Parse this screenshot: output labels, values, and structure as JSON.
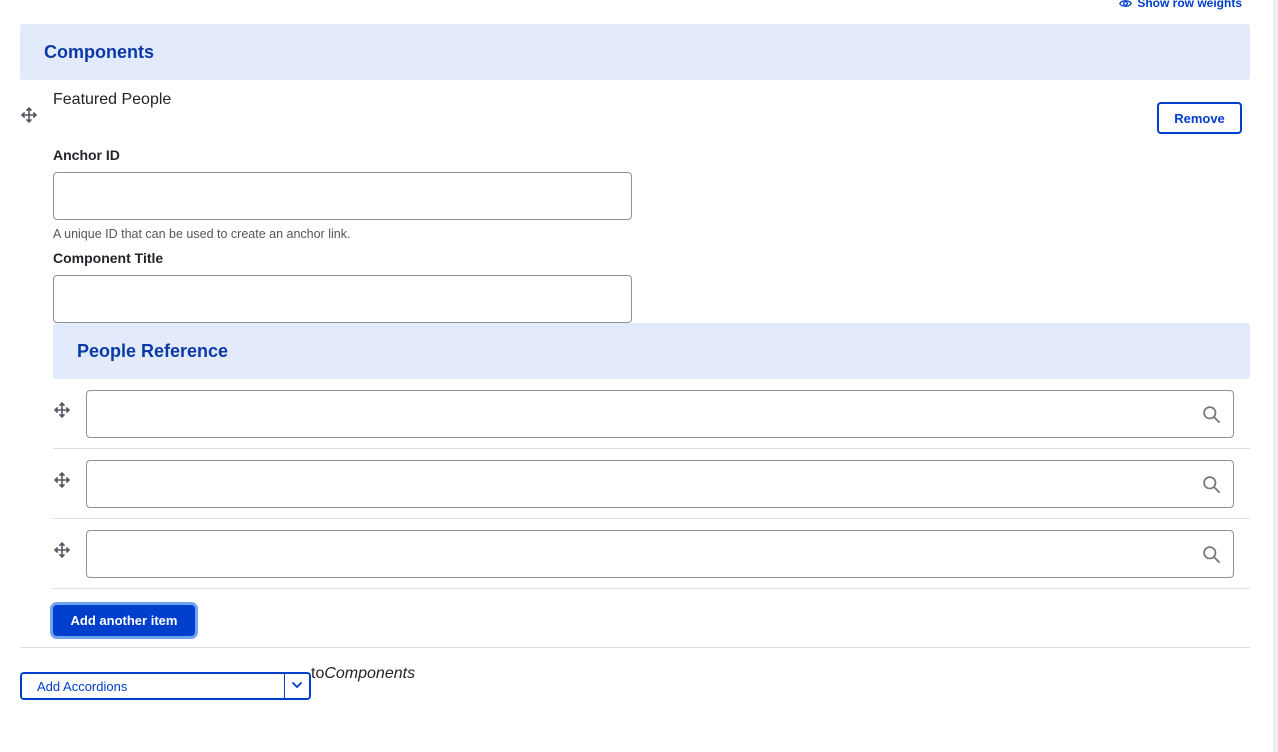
{
  "toolbar": {
    "show_row_weights": "Show row weights"
  },
  "components_section": {
    "title": "Components"
  },
  "featured_people": {
    "title": "Featured People",
    "remove_label": "Remove",
    "anchor_id": {
      "label": "Anchor ID",
      "value": "",
      "description": "A unique ID that can be used to create an anchor link."
    },
    "component_title": {
      "label": "Component Title",
      "value": ""
    },
    "people_reference": {
      "title": "People Reference",
      "items": [
        {
          "value": ""
        },
        {
          "value": ""
        },
        {
          "value": ""
        }
      ]
    },
    "add_another_label": "Add another item"
  },
  "footer": {
    "add_button_label": "Add Accordions",
    "to_label": "to",
    "target_label": "Components"
  },
  "colors": {
    "accent": "#003ecc",
    "header_bg": "#e3eafb",
    "header_text": "#0b3aa8",
    "focus_ring": "#6fa3f0"
  }
}
